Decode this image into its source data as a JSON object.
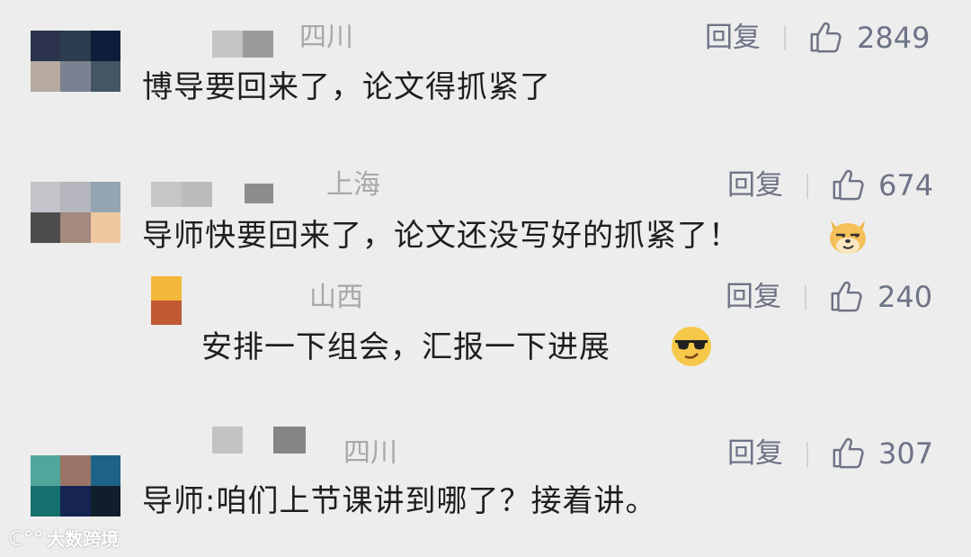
{
  "comments": [
    {
      "location": "四川",
      "reply_label": "回复",
      "likes": "2849",
      "text": "博导要回来了，论文得抓紧了",
      "avatar_colors": [
        "#2b344c",
        "#2d3c4f",
        "#0d1d3b",
        "#b7aaa0",
        "#7b8190",
        "#435664"
      ]
    },
    {
      "location": "上海",
      "reply_label": "回复",
      "likes": "674",
      "text": "导师快要回来了，论文还没写好的抓紧了！",
      "emoji": "smirk-dog-emoji",
      "avatar_colors": [
        "#c2c4c9",
        "#b5b6bd",
        "#94a4b3",
        "#4e4c4d",
        "#a48a7e",
        "#f0c8a0"
      ]
    },
    {
      "location": "山西",
      "reply_label": "回复",
      "likes": "240",
      "text": "安排一下组会，汇报一下进展",
      "emoji": "sunglasses-emoji",
      "avatar_colors": [
        "#f4b83c",
        "#c25a34"
      ]
    },
    {
      "location": "四川",
      "reply_label": "回复",
      "likes": "307",
      "text": "导师:咱们上节课讲到哪了？接着讲。",
      "avatar_colors": [
        "#4fa79c",
        "#9a7567",
        "#1d6287",
        "#15706e",
        "#152453",
        "#101d2a"
      ]
    }
  ],
  "watermark": {
    "text": "大数跨境",
    "icon": "cat-paw-logo-icon"
  }
}
